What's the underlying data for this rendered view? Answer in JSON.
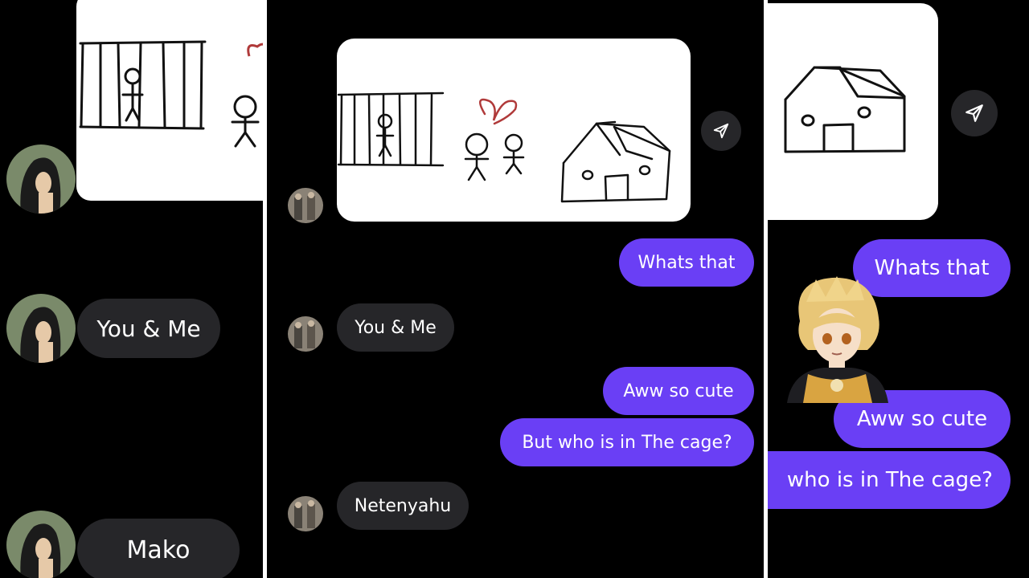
{
  "left_panel": {
    "messages": [
      "You & Me",
      "Mako"
    ]
  },
  "middle_panel": {
    "messages": {
      "incoming_1": "You & Me",
      "incoming_2": "Netenyahu",
      "outgoing_1": "Whats that",
      "outgoing_2": "Aww so cute",
      "outgoing_3": "But who is in The cage?"
    }
  },
  "right_panel": {
    "messages": {
      "outgoing_1": "Whats that",
      "outgoing_2": "Aww so cute",
      "outgoing_3": "who is in The cage?"
    }
  },
  "colors": {
    "background": "#000000",
    "incoming_bubble": "#262629",
    "outgoing_bubble": "#6a3ff5",
    "text": "#ffffff",
    "heart": "#b03a3a"
  },
  "icons": [
    "send-icon",
    "avatar",
    "character-sticker"
  ]
}
